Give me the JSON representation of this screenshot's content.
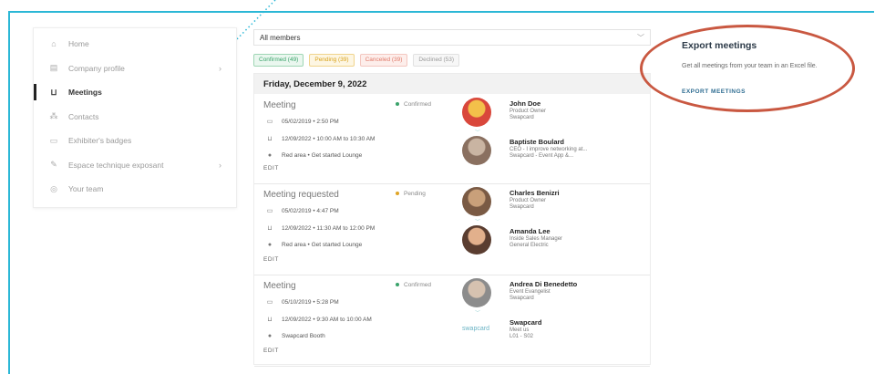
{
  "sidebar": {
    "items": [
      {
        "label": "Home",
        "icon": "home-icon",
        "glyph": "⌂",
        "chevron": false,
        "active": false
      },
      {
        "label": "Company profile",
        "icon": "building-icon",
        "glyph": "▤",
        "chevron": true,
        "active": false
      },
      {
        "label": "Meetings",
        "icon": "meetings-icon",
        "glyph": "⊔",
        "chevron": false,
        "active": true
      },
      {
        "label": "Contacts",
        "icon": "contacts-icon",
        "glyph": "⁂",
        "chevron": false,
        "active": false
      },
      {
        "label": "Exhibiter's badges",
        "icon": "badge-icon",
        "glyph": "▭",
        "chevron": false,
        "active": false
      },
      {
        "label": "Espace technique exposant",
        "icon": "tools-icon",
        "glyph": "✎",
        "chevron": true,
        "active": false
      },
      {
        "label": "Your team",
        "icon": "team-icon",
        "glyph": "◎",
        "chevron": false,
        "active": false
      }
    ]
  },
  "filter": {
    "value": "All members"
  },
  "tabs": [
    {
      "label": "Confirmed (49)",
      "kind": "conf"
    },
    {
      "label": "Pending (39)",
      "kind": "pend"
    },
    {
      "label": "Canceled (39)",
      "kind": "canc"
    },
    {
      "label": "Declined (53)",
      "kind": "decl"
    }
  ],
  "date_header": "Friday, December 9, 2022",
  "meetings": [
    {
      "title": "Meeting",
      "status": "Confirmed",
      "status_color": "#3aa36b",
      "created": "05/02/2019 • 2:50 PM",
      "time": "12/09/2022 • 10:00 AM to 10:30 AM",
      "location": "Red area • Get started Lounge",
      "edit": "EDIT",
      "people": [
        {
          "name": "John Doe",
          "lines": [
            "Product Owner",
            "Swapcard"
          ],
          "avatar_color": "#d9473b",
          "avatar_accent": "#f3c04a"
        },
        {
          "name": "Baptiste Boulard",
          "lines": [
            "CEO - I improve networking at...",
            "Swapcard - Event App &..."
          ],
          "avatar_color": "#8a7060",
          "avatar_accent": "#c9b4a2"
        }
      ]
    },
    {
      "title": "Meeting requested",
      "status": "Pending",
      "status_color": "#e0a526",
      "created": "05/02/2019 • 4:47 PM",
      "time": "12/09/2022 • 11:30 AM to 12:00 PM",
      "location": "Red area • Get started Lounge",
      "edit": "EDIT",
      "people": [
        {
          "name": "Charles Benizri",
          "lines": [
            "Product Owner",
            "Swapcard"
          ],
          "avatar_color": "#7a5a44",
          "avatar_accent": "#c9a07a"
        },
        {
          "name": "Amanda Lee",
          "lines": [
            "Inside Sales Manager",
            "General Electric"
          ],
          "avatar_color": "#5a3d30",
          "avatar_accent": "#e2b08c"
        }
      ]
    },
    {
      "title": "Meeting",
      "status": "Confirmed",
      "status_color": "#3aa36b",
      "created": "05/10/2019 • 5:28 PM",
      "time": "12/09/2022 • 9:30 AM to 10:00 AM",
      "location": "Swapcard Booth",
      "edit": "EDIT",
      "people": [
        {
          "name": "Andrea Di Benedetto",
          "lines": [
            "Event Evangelist",
            "Swapcard"
          ],
          "avatar_color": "#8c8c8c",
          "avatar_accent": "#d6c2b0"
        },
        {
          "name": "Swapcard",
          "lines": [
            "Meet us",
            "L01 - S02"
          ],
          "brand": "swapcard"
        }
      ]
    }
  ],
  "export": {
    "title": "Export meetings",
    "description": "Get all meetings from your team in an Excel file.",
    "link": "EXPORT MEETINGS"
  },
  "colors": {
    "accent": "#2bb7d6",
    "highlight_ring": "#c95841"
  }
}
